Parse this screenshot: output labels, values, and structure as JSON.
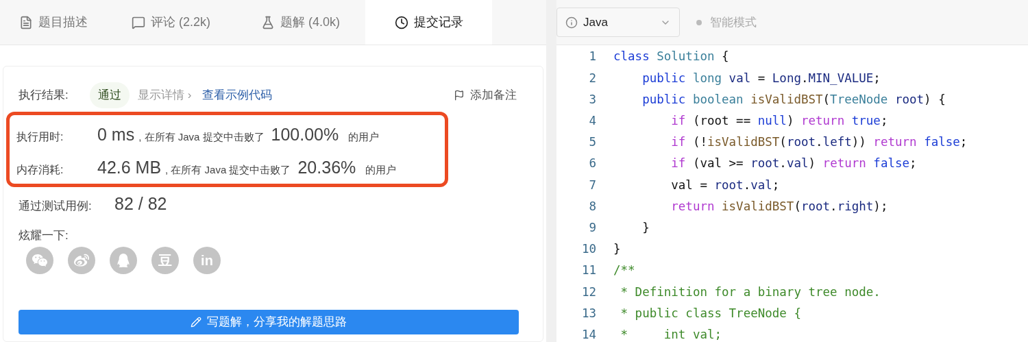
{
  "tabs": [
    {
      "label": "题目描述",
      "selected": false
    },
    {
      "label": "评论 (2.2k)",
      "selected": false
    },
    {
      "label": "题解 (4.0k)",
      "selected": false
    },
    {
      "label": "提交记录",
      "selected": true
    }
  ],
  "result": {
    "label": "执行结果:",
    "status": "通过",
    "details": "显示详情 ›",
    "sample_link": "查看示例代码",
    "note": "添加备注"
  },
  "stats": [
    {
      "label": "执行用时:",
      "value": "0 ms",
      "text": ", 在所有 Java 提交中击败了",
      "percent": "100.00%",
      "suffix": "的用户"
    },
    {
      "label": "内存消耗:",
      "value": "42.6 MB",
      "text": ", 在所有 Java 提交中击败了",
      "percent": "20.36%",
      "suffix": "的用户"
    }
  ],
  "tests": {
    "label": "通过测试用例:",
    "value": "82 / 82"
  },
  "share": {
    "label": "炫耀一下:",
    "items": [
      {
        "kind": "wechat"
      },
      {
        "kind": "weibo"
      },
      {
        "kind": "qq"
      },
      {
        "kind": "text",
        "text": "豆"
      },
      {
        "kind": "text",
        "text": "in"
      }
    ]
  },
  "write_button": "写题解，分享我的解题思路",
  "editor": {
    "language": "Java",
    "mode": "智能模式",
    "lines": [
      {
        "number": "1",
        "tokens": [
          {
            "t": "class ",
            "kind": "kw"
          },
          {
            "t": "Solution",
            "kind": "type"
          },
          {
            "t": " {",
            "kind": "plain"
          }
        ]
      },
      {
        "number": "2",
        "tokens": [
          {
            "t": "    public ",
            "kind": "kw"
          },
          {
            "t": "long ",
            "kind": "type"
          },
          {
            "t": "val",
            "kind": "var"
          },
          {
            "t": " = ",
            "kind": "plain"
          },
          {
            "t": "Long",
            "kind": "var"
          },
          {
            "t": ".",
            "kind": "plain"
          },
          {
            "t": "MIN_VALUE",
            "kind": "var"
          },
          {
            "t": ";",
            "kind": "plain"
          }
        ]
      },
      {
        "number": "3",
        "tokens": [
          {
            "t": "    public ",
            "kind": "kw"
          },
          {
            "t": "boolean ",
            "kind": "type"
          },
          {
            "t": "isValidBST",
            "kind": "fn"
          },
          {
            "t": "(",
            "kind": "plain"
          },
          {
            "t": "TreeNode ",
            "kind": "type"
          },
          {
            "t": "root",
            "kind": "var"
          },
          {
            "t": ") {",
            "kind": "plain"
          }
        ]
      },
      {
        "number": "4",
        "tokens": [
          {
            "t": "        if ",
            "kind": "ctl"
          },
          {
            "t": "(root == ",
            "kind": "plain"
          },
          {
            "t": "null",
            "kind": "kw"
          },
          {
            "t": ") ",
            "kind": "plain"
          },
          {
            "t": "return ",
            "kind": "ctl"
          },
          {
            "t": "true",
            "kind": "kw"
          },
          {
            "t": ";",
            "kind": "plain"
          }
        ]
      },
      {
        "number": "5",
        "tokens": [
          {
            "t": "        if ",
            "kind": "ctl"
          },
          {
            "t": "(!",
            "kind": "plain"
          },
          {
            "t": "isValidBST",
            "kind": "fn"
          },
          {
            "t": "(",
            "kind": "plain"
          },
          {
            "t": "root",
            "kind": "var"
          },
          {
            "t": ".",
            "kind": "plain"
          },
          {
            "t": "left",
            "kind": "var"
          },
          {
            "t": ")) ",
            "kind": "plain"
          },
          {
            "t": "return ",
            "kind": "ctl"
          },
          {
            "t": "false",
            "kind": "kw"
          },
          {
            "t": ";",
            "kind": "plain"
          }
        ]
      },
      {
        "number": "6",
        "tokens": [
          {
            "t": "        if ",
            "kind": "ctl"
          },
          {
            "t": "(val >= ",
            "kind": "plain"
          },
          {
            "t": "root",
            "kind": "var"
          },
          {
            "t": ".",
            "kind": "plain"
          },
          {
            "t": "val",
            "kind": "var"
          },
          {
            "t": ") ",
            "kind": "plain"
          },
          {
            "t": "return ",
            "kind": "ctl"
          },
          {
            "t": "false",
            "kind": "kw"
          },
          {
            "t": ";",
            "kind": "plain"
          }
        ]
      },
      {
        "number": "7",
        "tokens": [
          {
            "t": "        val = ",
            "kind": "plain"
          },
          {
            "t": "root",
            "kind": "var"
          },
          {
            "t": ".",
            "kind": "plain"
          },
          {
            "t": "val",
            "kind": "var"
          },
          {
            "t": ";",
            "kind": "plain"
          }
        ]
      },
      {
        "number": "8",
        "tokens": [
          {
            "t": "        return ",
            "kind": "ctl"
          },
          {
            "t": "isValidBST",
            "kind": "fn"
          },
          {
            "t": "(",
            "kind": "plain"
          },
          {
            "t": "root",
            "kind": "var"
          },
          {
            "t": ".",
            "kind": "plain"
          },
          {
            "t": "right",
            "kind": "var"
          },
          {
            "t": ");",
            "kind": "plain"
          }
        ]
      },
      {
        "number": "9",
        "tokens": [
          {
            "t": "    }",
            "kind": "plain"
          }
        ]
      },
      {
        "number": "10",
        "tokens": [
          {
            "t": "}",
            "kind": "plain"
          }
        ]
      },
      {
        "number": "11",
        "tokens": [
          {
            "t": "/**",
            "kind": "comment"
          }
        ]
      },
      {
        "number": "12",
        "tokens": [
          {
            "t": " * Definition for a binary tree node.",
            "kind": "comment"
          }
        ]
      },
      {
        "number": "13",
        "tokens": [
          {
            "t": " * public class TreeNode {",
            "kind": "comment"
          }
        ]
      },
      {
        "number": "14",
        "tokens": [
          {
            "t": " *     int val;",
            "kind": "comment"
          }
        ]
      }
    ]
  }
}
